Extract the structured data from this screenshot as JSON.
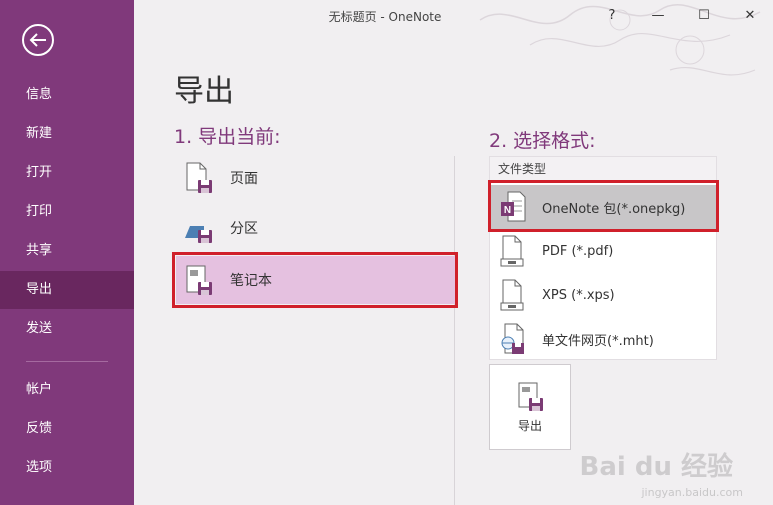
{
  "window": {
    "title": "无标题页 - OneNote",
    "help": "?",
    "minimize": "—",
    "maximize": "☐",
    "close": "✕"
  },
  "sidebar": {
    "items": [
      {
        "label": "信息"
      },
      {
        "label": "新建"
      },
      {
        "label": "打开"
      },
      {
        "label": "打印"
      },
      {
        "label": "共享"
      },
      {
        "label": "导出",
        "active": true
      },
      {
        "label": "发送"
      },
      {
        "label": "帐户"
      },
      {
        "label": "反馈"
      },
      {
        "label": "选项"
      }
    ]
  },
  "main": {
    "title": "导出",
    "step1": "1. 导出当前:",
    "step2": "2. 选择格式:",
    "scope": [
      {
        "label": "页面"
      },
      {
        "label": "分区"
      },
      {
        "label": "笔记本",
        "selected": true
      }
    ],
    "format_header": "文件类型",
    "formats": [
      {
        "label": "OneNote 包(*.onepkg)",
        "selected": true
      },
      {
        "label": "PDF (*.pdf)"
      },
      {
        "label": "XPS (*.xps)"
      },
      {
        "label": "单文件网页(*.mht)"
      }
    ],
    "export_button": "导出"
  },
  "watermark": {
    "brand": "Bai du 经验",
    "url": "jingyan.baidu.com"
  },
  "colors": {
    "accent": "#80397b",
    "accent_dark": "#69275f",
    "highlight": "#d0202b",
    "selected_scope": "#e5c1e0"
  }
}
